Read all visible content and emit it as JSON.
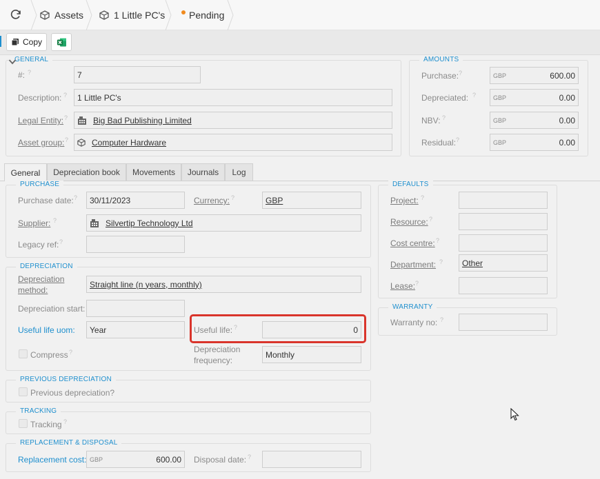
{
  "breadcrumb": {
    "items": [
      {
        "label": "Assets"
      },
      {
        "label": "1 Little PC's"
      },
      {
        "label": "Pending"
      }
    ],
    "status_color": "#f08a1e"
  },
  "toolbar": {
    "copy_label": "Copy",
    "excel_icon": "excel-icon"
  },
  "general": {
    "legend": "GENERAL",
    "number_label": "#:",
    "number_value": "7",
    "description_label": "Description:",
    "description_value": "1 Little PC's",
    "legal_entity_label": "Legal Entity:",
    "legal_entity_value": "Big Bad Publishing Limited",
    "asset_group_label": "Asset group:",
    "asset_group_value": "Computer Hardware"
  },
  "amounts": {
    "legend": "AMOUNTS",
    "rows": [
      {
        "label": "Purchase:",
        "currency": "GBP",
        "value": "600.00"
      },
      {
        "label": "Depreciated:",
        "currency": "GBP",
        "value": "0.00"
      },
      {
        "label": "NBV:",
        "currency": "GBP",
        "value": "0.00"
      },
      {
        "label": "Residual:",
        "currency": "GBP",
        "value": "0.00"
      }
    ]
  },
  "tabs": [
    {
      "label": "General"
    },
    {
      "label": "Depreciation book"
    },
    {
      "label": "Movements"
    },
    {
      "label": "Journals"
    },
    {
      "label": "Log"
    }
  ],
  "purchase": {
    "legend": "PURCHASE",
    "date_label": "Purchase date:",
    "date_value": "30/11/2023",
    "currency_label": "Currency:",
    "currency_value": "GBP",
    "supplier_label": "Supplier:",
    "supplier_value": "Silvertip Technology Ltd",
    "legacy_label": "Legacy ref:",
    "legacy_value": ""
  },
  "depreciation": {
    "legend": "DEPRECIATION",
    "method_label_1": "Depreciation",
    "method_label_2": "method:",
    "method_value": "Straight line (n years, monthly)",
    "start_label": "Depreciation start:",
    "start_value": "",
    "uom_label": "Useful life uom:",
    "uom_value": "Year",
    "life_label": "Useful life:",
    "life_value": "0",
    "compress_label": "Compress",
    "freq_label_1": "Depreciation",
    "freq_label_2": "frequency:",
    "freq_value": "Monthly",
    "highlight_color": "#d9342b"
  },
  "previous_depreciation": {
    "legend": "PREVIOUS DEPRECIATION",
    "checkbox_label": "Previous depreciation?"
  },
  "tracking": {
    "legend": "TRACKING",
    "checkbox_label": "Tracking"
  },
  "replacement": {
    "legend": "REPLACEMENT & DISPOSAL",
    "cost_label": "Replacement cost:",
    "cost_currency": "GBP",
    "cost_value": "600.00",
    "disposal_label": "Disposal date:",
    "disposal_value": ""
  },
  "defaults": {
    "legend": "DEFAULTS",
    "rows": [
      {
        "label": "Project:",
        "value": ""
      },
      {
        "label": "Resource:",
        "value": ""
      },
      {
        "label": "Cost centre:",
        "value": ""
      },
      {
        "label": "Department:",
        "value": "Other"
      },
      {
        "label": "Lease:",
        "value": ""
      }
    ]
  },
  "warranty": {
    "legend": "WARRANTY",
    "no_label": "Warranty no:",
    "no_value": ""
  },
  "colors": {
    "accent": "#1e8fce"
  }
}
